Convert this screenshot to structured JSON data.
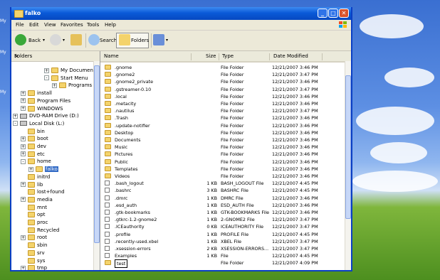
{
  "desktop": {
    "icon_labels": [
      "My",
      "My",
      "My"
    ]
  },
  "window": {
    "title": "falko"
  },
  "menu": [
    "File",
    "Edit",
    "View",
    "Favorites",
    "Tools",
    "Help"
  ],
  "toolbar": {
    "back": "Back",
    "search": "Search",
    "folders": "Folders"
  },
  "folders_pane": {
    "title": "Folders",
    "tree": [
      {
        "label": "My Documents",
        "level": 5,
        "expander": "+",
        "kind": "folder"
      },
      {
        "label": "Start Menu",
        "level": 5,
        "expander": "-",
        "kind": "folder"
      },
      {
        "label": "Programs",
        "level": 6,
        "expander": "+",
        "kind": "folder"
      },
      {
        "label": "install",
        "level": 2,
        "expander": "+",
        "kind": "folder"
      },
      {
        "label": "Program Files",
        "level": 2,
        "expander": "+",
        "kind": "folder"
      },
      {
        "label": "WINDOWS",
        "level": 2,
        "expander": "+",
        "kind": "folder"
      },
      {
        "label": "DVD-RAM Drive (D:)",
        "level": 1,
        "expander": "+",
        "kind": "drive"
      },
      {
        "label": "Local Disk (L:)",
        "level": 1,
        "expander": "-",
        "kind": "drive"
      },
      {
        "label": "bin",
        "level": 2,
        "expander": "",
        "kind": "folder"
      },
      {
        "label": "boot",
        "level": 2,
        "expander": "+",
        "kind": "folder"
      },
      {
        "label": "dev",
        "level": 2,
        "expander": "+",
        "kind": "folder"
      },
      {
        "label": "etc",
        "level": 2,
        "expander": "+",
        "kind": "folder"
      },
      {
        "label": "home",
        "level": 2,
        "expander": "-",
        "kind": "folder"
      },
      {
        "label": "falko",
        "level": 3,
        "expander": "+",
        "kind": "folder",
        "selected": true
      },
      {
        "label": "initrd",
        "level": 2,
        "expander": "",
        "kind": "folder"
      },
      {
        "label": "lib",
        "level": 2,
        "expander": "+",
        "kind": "folder"
      },
      {
        "label": "lost+found",
        "level": 2,
        "expander": "",
        "kind": "folder"
      },
      {
        "label": "media",
        "level": 2,
        "expander": "+",
        "kind": "folder"
      },
      {
        "label": "mnt",
        "level": 2,
        "expander": "",
        "kind": "folder"
      },
      {
        "label": "opt",
        "level": 2,
        "expander": "",
        "kind": "folder"
      },
      {
        "label": "proc",
        "level": 2,
        "expander": "",
        "kind": "folder"
      },
      {
        "label": "Recycled",
        "level": 2,
        "expander": "",
        "kind": "folder"
      },
      {
        "label": "root",
        "level": 2,
        "expander": "+",
        "kind": "folder"
      },
      {
        "label": "sbin",
        "level": 2,
        "expander": "",
        "kind": "folder"
      },
      {
        "label": "srv",
        "level": 2,
        "expander": "",
        "kind": "folder"
      },
      {
        "label": "sys",
        "level": 2,
        "expander": "",
        "kind": "folder"
      },
      {
        "label": "tmp",
        "level": 2,
        "expander": "+",
        "kind": "folder"
      }
    ]
  },
  "file_list": {
    "columns": [
      "Name",
      "Size",
      "Type",
      "Date Modified"
    ],
    "rows": [
      {
        "name": ".gnome",
        "size": "",
        "type": "File Folder",
        "date": "12/21/2007 3:46 PM",
        "kind": "folder"
      },
      {
        "name": ".gnome2",
        "size": "",
        "type": "File Folder",
        "date": "12/21/2007 3:47 PM",
        "kind": "folder"
      },
      {
        "name": ".gnome2_private",
        "size": "",
        "type": "File Folder",
        "date": "12/21/2007 3:46 PM",
        "kind": "folder"
      },
      {
        "name": ".gstreamer-0.10",
        "size": "",
        "type": "File Folder",
        "date": "12/21/2007 3:47 PM",
        "kind": "folder"
      },
      {
        "name": ".local",
        "size": "",
        "type": "File Folder",
        "date": "12/21/2007 3:46 PM",
        "kind": "folder"
      },
      {
        "name": ".metacity",
        "size": "",
        "type": "File Folder",
        "date": "12/21/2007 3:46 PM",
        "kind": "folder"
      },
      {
        "name": ".nautilus",
        "size": "",
        "type": "File Folder",
        "date": "12/21/2007 3:47 PM",
        "kind": "folder"
      },
      {
        "name": ".Trash",
        "size": "",
        "type": "File Folder",
        "date": "12/21/2007 3:46 PM",
        "kind": "folder"
      },
      {
        "name": ".update-notifier",
        "size": "",
        "type": "File Folder",
        "date": "12/21/2007 3:46 PM",
        "kind": "folder"
      },
      {
        "name": "Desktop",
        "size": "",
        "type": "File Folder",
        "date": "12/21/2007 3:46 PM",
        "kind": "folder"
      },
      {
        "name": "Documents",
        "size": "",
        "type": "File Folder",
        "date": "12/21/2007 3:46 PM",
        "kind": "folder"
      },
      {
        "name": "Music",
        "size": "",
        "type": "File Folder",
        "date": "12/21/2007 3:46 PM",
        "kind": "folder"
      },
      {
        "name": "Pictures",
        "size": "",
        "type": "File Folder",
        "date": "12/21/2007 3:46 PM",
        "kind": "folder"
      },
      {
        "name": "Public",
        "size": "",
        "type": "File Folder",
        "date": "12/21/2007 3:46 PM",
        "kind": "folder"
      },
      {
        "name": "Templates",
        "size": "",
        "type": "File Folder",
        "date": "12/21/2007 3:46 PM",
        "kind": "folder"
      },
      {
        "name": "Videos",
        "size": "",
        "type": "File Folder",
        "date": "12/21/2007 3:46 PM",
        "kind": "folder"
      },
      {
        "name": ".bash_logout",
        "size": "1 KB",
        "type": "BASH_LOGOUT File",
        "date": "12/21/2007 4:45 PM",
        "kind": "file"
      },
      {
        "name": ".bashrc",
        "size": "3 KB",
        "type": "BASHRC File",
        "date": "12/21/2007 4:45 PM",
        "kind": "file"
      },
      {
        "name": ".dmrc",
        "size": "1 KB",
        "type": "DMRC File",
        "date": "12/21/2007 3:46 PM",
        "kind": "file"
      },
      {
        "name": ".esd_auth",
        "size": "1 KB",
        "type": "ESD_AUTH File",
        "date": "12/21/2007 3:46 PM",
        "kind": "file"
      },
      {
        "name": ".gtk-bookmarks",
        "size": "1 KB",
        "type": "GTK-BOOKMARKS File",
        "date": "12/21/2007 3:46 PM",
        "kind": "file"
      },
      {
        "name": ".gtkrc-1.2-gnome2",
        "size": "1 KB",
        "type": "2-GNOME2 File",
        "date": "12/21/2007 3:47 PM",
        "kind": "file"
      },
      {
        "name": ".ICEauthority",
        "size": "0 KB",
        "type": "ICEAUTHORITY File",
        "date": "12/21/2007 3:47 PM",
        "kind": "file"
      },
      {
        "name": ".profile",
        "size": "1 KB",
        "type": "PROFILE File",
        "date": "12/21/2007 4:45 PM",
        "kind": "file"
      },
      {
        "name": ".recently-used.xbel",
        "size": "1 KB",
        "type": "XBEL File",
        "date": "12/21/2007 3:47 PM",
        "kind": "file"
      },
      {
        "name": ".xsession-errors",
        "size": "2 KB",
        "type": "XSESSION-ERRORS...",
        "date": "12/21/2007 3:47 PM",
        "kind": "file"
      },
      {
        "name": "Examples",
        "size": "1 KB",
        "type": "File",
        "date": "12/21/2007 4:45 PM",
        "kind": "file"
      },
      {
        "name": "test",
        "size": "",
        "type": "File Folder",
        "date": "12/21/2007 4:09 PM",
        "kind": "folder",
        "renaming": true
      }
    ]
  }
}
